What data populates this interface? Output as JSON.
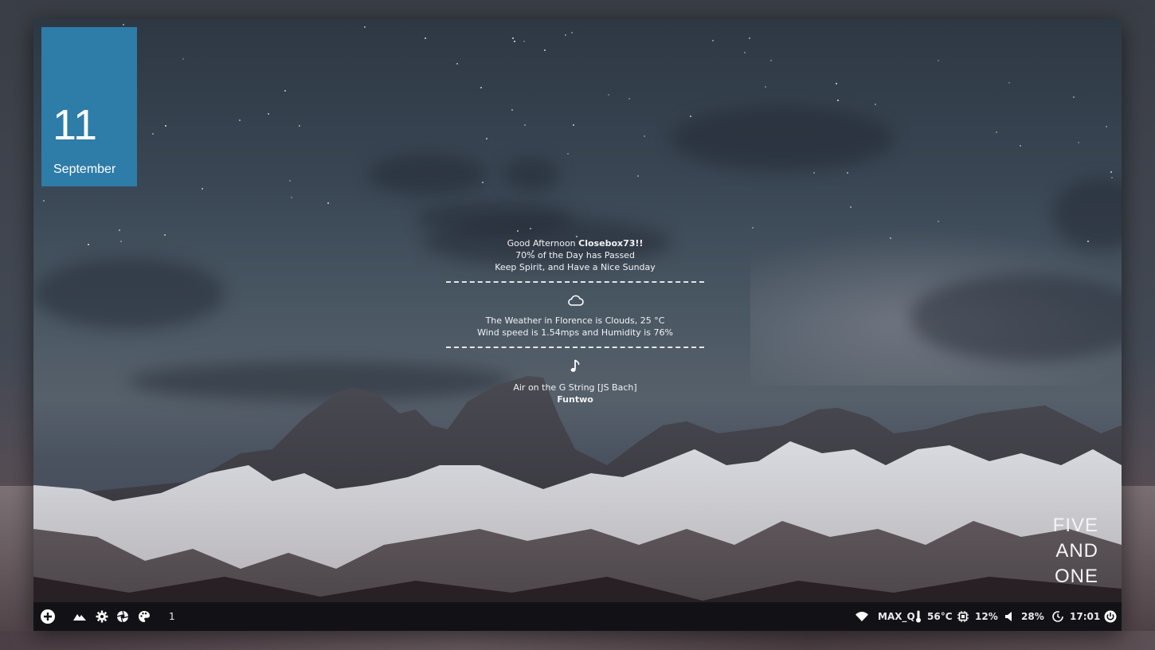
{
  "date_tile": {
    "day": "11",
    "month": "September"
  },
  "greeting": {
    "prefix": "Good Afternoon",
    "user": "Closebox73!!",
    "day_progress": "70% of the Day has Passed",
    "motto": "Keep Spirit, and Have a Nice Sunday"
  },
  "weather": {
    "icon": "cloud-icon",
    "line1": "The Weather in Florence is Clouds, 25 °C",
    "line2": "Wind speed is 1.54mps and Humidity is 76%"
  },
  "music": {
    "icon": "music-note-icon",
    "track": "Air on the G String [JS Bach]",
    "artist": "Funtwo"
  },
  "corner_text": [
    "FIVE",
    "AND",
    "ONE"
  ],
  "taskbar": {
    "left": {
      "launcher_icon": "plus-circle-icon",
      "icons": [
        "mountain-icon",
        "gear-icon",
        "aperture-icon",
        "palette-icon"
      ],
      "workspace": "1"
    },
    "right": {
      "wifi_icon": "wifi-icon",
      "network": "MAX_Q",
      "temp_icon": "thermometer-icon",
      "temperature": "56°C",
      "cpu_icon": "cpu-icon",
      "cpu": "12%",
      "volume_icon": "speaker-icon",
      "volume": "28%",
      "clock_icon": "clock-icon",
      "time": "17:01",
      "power_icon": "power-icon"
    }
  },
  "colors": {
    "date_tile": "#2e7ca8",
    "taskbar": "#121216",
    "text": "#f2f2f4"
  }
}
